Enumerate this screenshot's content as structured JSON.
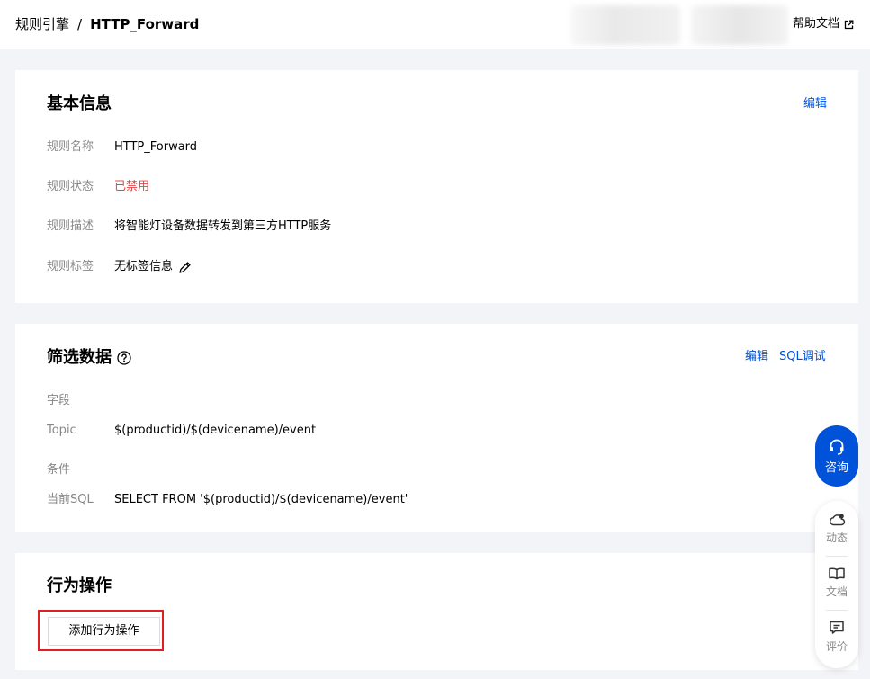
{
  "breadcrumb": {
    "parent": "规则引擎",
    "separator": "/",
    "current": "HTTP_Forward"
  },
  "header": {
    "help_label": "帮助文档"
  },
  "basic_info": {
    "title": "基本信息",
    "edit_label": "编辑",
    "rows": [
      {
        "label": "规则名称",
        "value": "HTTP_Forward"
      },
      {
        "label": "规则状态",
        "value": "已禁用"
      },
      {
        "label": "规则描述",
        "value": "将智能灯设备数据转发到第三方HTTP服务"
      },
      {
        "label": "规则标签",
        "value": "无标签信息"
      }
    ]
  },
  "filter": {
    "title": "筛选数据",
    "edit_label": "编辑",
    "sql_debug_label": "SQL调试",
    "field_section_label": "字段",
    "topic_label": "Topic",
    "topic_value": "$(productid)/$(devicename)/event",
    "condition_section_label": "条件",
    "sql_label": "当前SQL",
    "sql_value": "SELECT FROM '$(productid)/$(devicename)/event'"
  },
  "actions": {
    "title": "行为操作",
    "add_label": "添加行为操作"
  },
  "float": {
    "consult_label": "咨询",
    "news_label": "动态",
    "docs_label": "文档",
    "review_label": "评价"
  },
  "colors": {
    "accent": "#0052d9",
    "danger": "#e54545",
    "highlight_border": "#e02020"
  }
}
